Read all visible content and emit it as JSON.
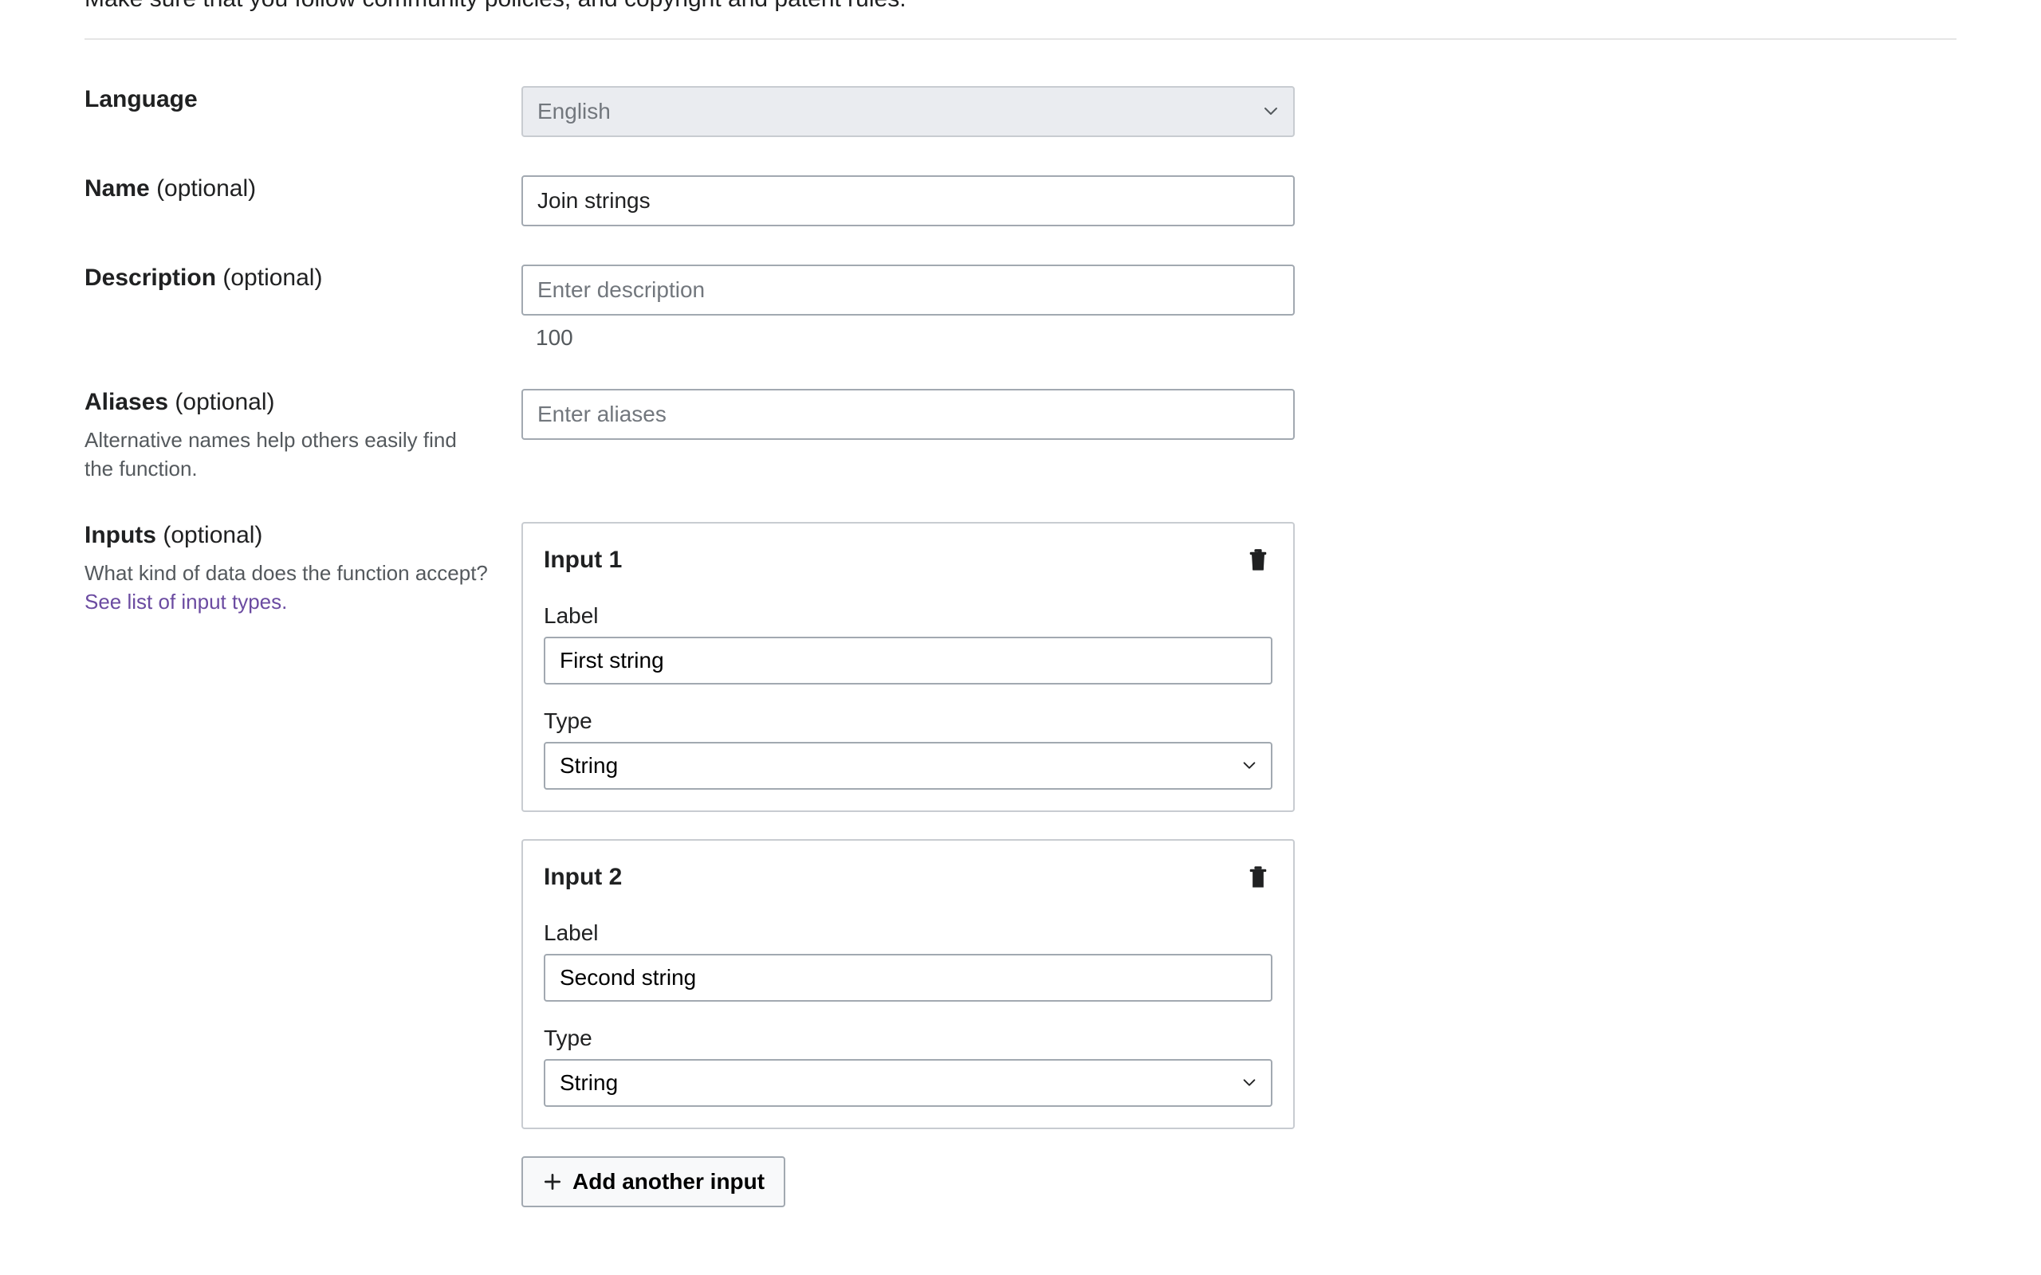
{
  "intro": "Make sure that you follow community policies, and copyright and patent rules.",
  "fields": {
    "language": {
      "label": "Language",
      "value": "English"
    },
    "name": {
      "label": "Name",
      "optional": "(optional)",
      "value": "Join strings"
    },
    "description": {
      "label": "Description",
      "optional": "(optional)",
      "placeholder": "Enter description",
      "hint": "100"
    },
    "aliases": {
      "label": "Aliases",
      "optional": "(optional)",
      "placeholder": "Enter aliases",
      "help": "Alternative names help others easily find the function."
    },
    "inputs": {
      "label": "Inputs",
      "optional": "(optional)",
      "help": "What kind of data does the function accept?",
      "link": "See list of input types.",
      "labelFieldLabel": "Label",
      "typeFieldLabel": "Type",
      "items": [
        {
          "title": "Input 1",
          "label": "First string",
          "type": "String"
        },
        {
          "title": "Input 2",
          "label": "Second string",
          "type": "String"
        }
      ],
      "addLabel": "Add another input"
    }
  }
}
